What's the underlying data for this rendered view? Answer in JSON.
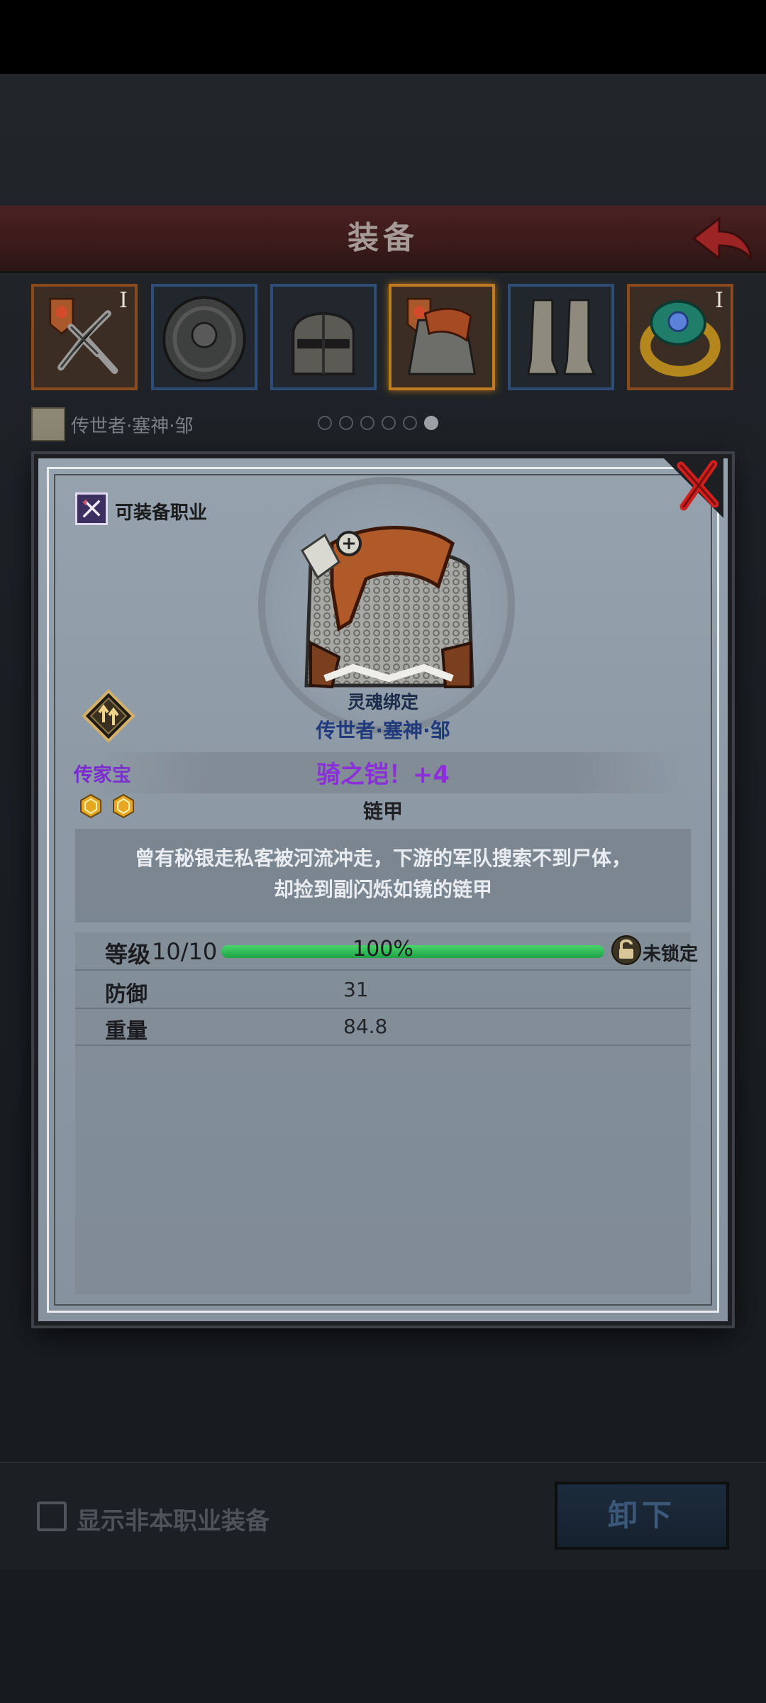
{
  "header": {
    "title": "装备"
  },
  "slots": [
    {
      "kind": "weapon",
      "tier": "I",
      "border": "orange"
    },
    {
      "kind": "shield",
      "tier": "",
      "border": "blue"
    },
    {
      "kind": "helmet",
      "tier": "",
      "border": "blue"
    },
    {
      "kind": "armor",
      "tier": "",
      "border": "selected"
    },
    {
      "kind": "boots",
      "tier": "",
      "border": "blue"
    },
    {
      "kind": "ring",
      "tier": "I",
      "border": "orange"
    }
  ],
  "hero": {
    "name": "传世者·塞神·邹"
  },
  "pagination": {
    "count": 6,
    "active": 5
  },
  "modal": {
    "class_label": "可装备职业",
    "soulbound": "灵魂绑定",
    "owner": "传世者·塞神·邹",
    "heirloom_label": "传家宝",
    "gem_count": 2,
    "item_name": "骑之铠！+4",
    "item_type": "链甲",
    "description": [
      "曾有秘银走私客被河流冲走，下游的军队搜索不到尸体，",
      "却捡到副闪烁如镜的链甲"
    ],
    "level": {
      "label": "等级",
      "value": "10/10",
      "progress_text": "100%",
      "progress": 1.0,
      "lock_text": "未锁定"
    },
    "stats": [
      {
        "label": "防御",
        "value": "31"
      },
      {
        "label": "重量",
        "value": "84.8"
      }
    ]
  },
  "footer": {
    "show_other_label": "显示非本职业装备",
    "unequip_label": "卸下"
  },
  "colors": {
    "header_red": "#4a2121",
    "item_name": "#8b2fd8",
    "owner_blue": "#203a7c",
    "xp_green": "#2fbf55",
    "close_red": "#d0201e"
  }
}
